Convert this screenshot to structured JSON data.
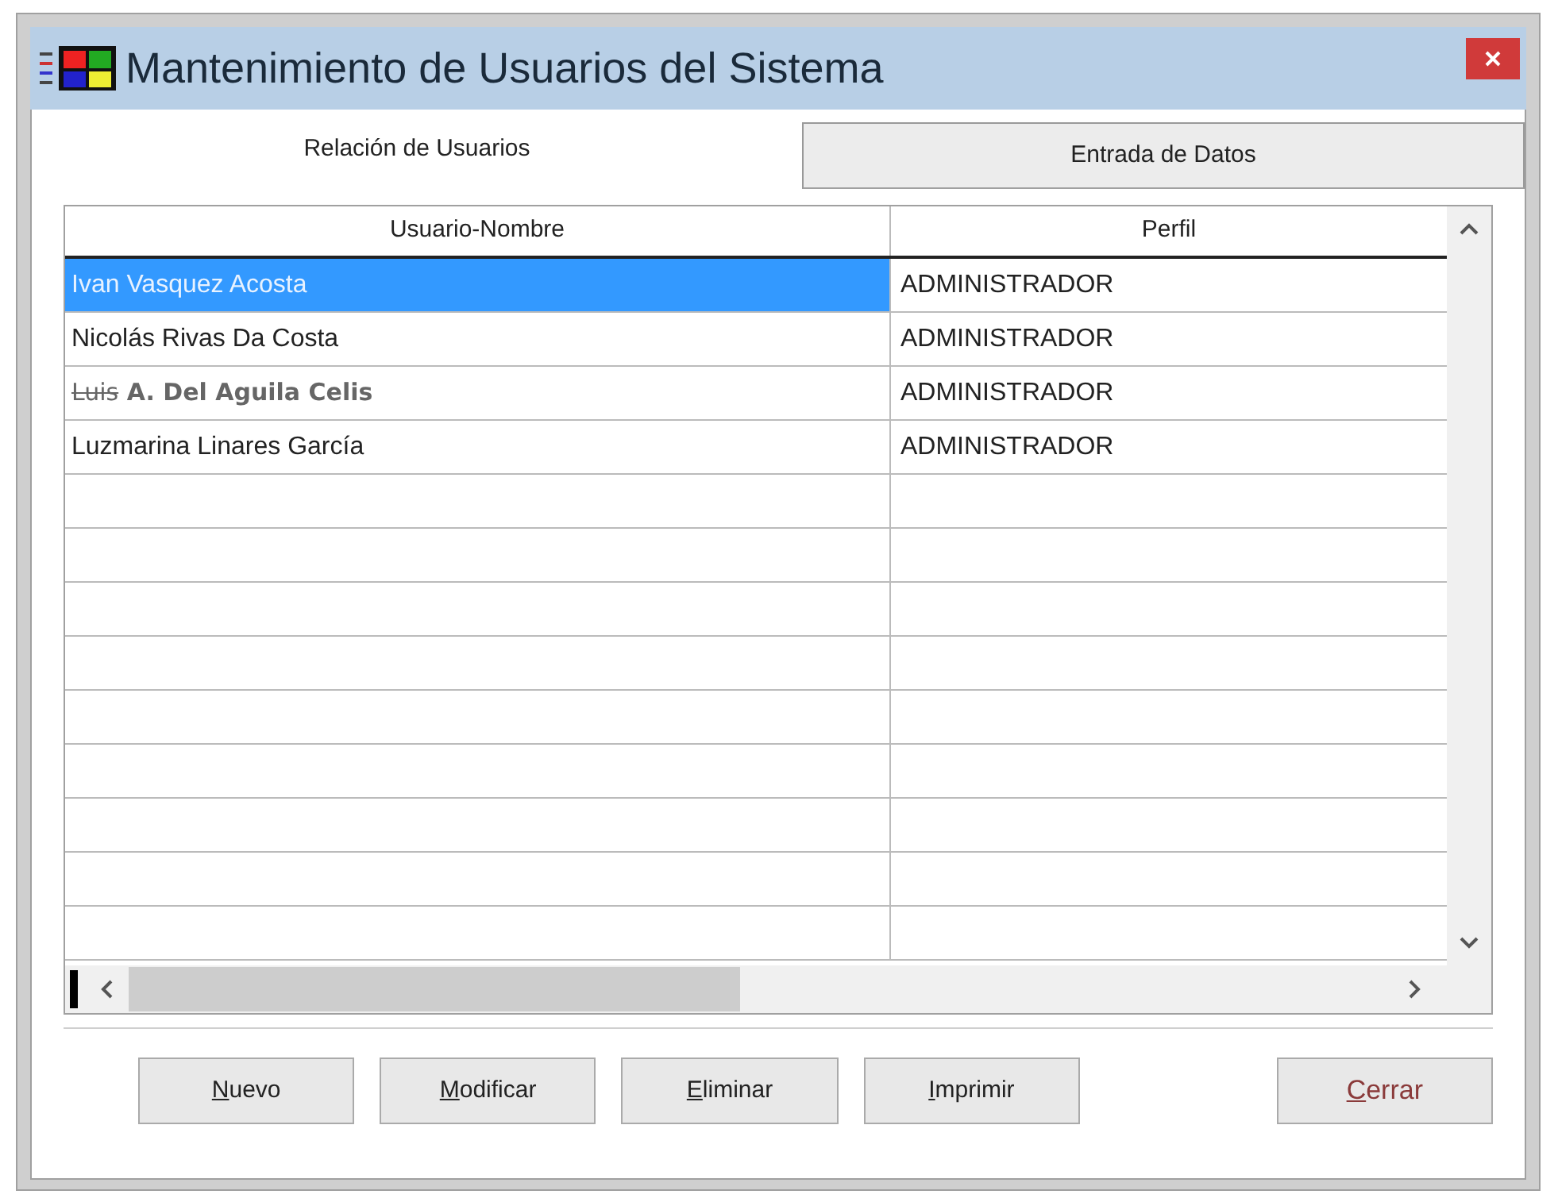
{
  "window": {
    "title": "Mantenimiento de Usuarios del Sistema"
  },
  "tabs": [
    {
      "label": "Relación de Usuarios",
      "selected": true
    },
    {
      "label": "Entrada de Datos",
      "selected": false
    }
  ],
  "table": {
    "columns": [
      "Usuario-Nombre",
      "Perfil"
    ],
    "rows": [
      {
        "selected": true,
        "name_parts": [
          {
            "text": "Ivan Vasquez Acosta",
            "struck": false
          }
        ],
        "edited": false,
        "perfil": "ADMINISTRADOR"
      },
      {
        "selected": false,
        "name_parts": [
          {
            "text": "Nicolás Rivas Da Costa",
            "struck": false
          }
        ],
        "edited": false,
        "perfil": "ADMINISTRADOR"
      },
      {
        "selected": false,
        "name_parts": [
          {
            "text": "Luis",
            "struck": true
          },
          {
            "text": " A. Del Aguila Celis",
            "struck": false
          }
        ],
        "edited": true,
        "perfil": "ADMINISTRADOR"
      },
      {
        "selected": false,
        "name_parts": [
          {
            "text": "Luzmarina Linares García",
            "struck": false
          }
        ],
        "edited": false,
        "perfil": "ADMINISTRADOR"
      }
    ]
  },
  "buttons": [
    {
      "label": "Nuevo",
      "kind": "action"
    },
    {
      "label": "Modificar",
      "kind": "action"
    },
    {
      "label": "Eliminar",
      "kind": "action"
    },
    {
      "label": "Imprimir",
      "kind": "action"
    },
    {
      "label": "Cerrar",
      "kind": "close"
    }
  ]
}
